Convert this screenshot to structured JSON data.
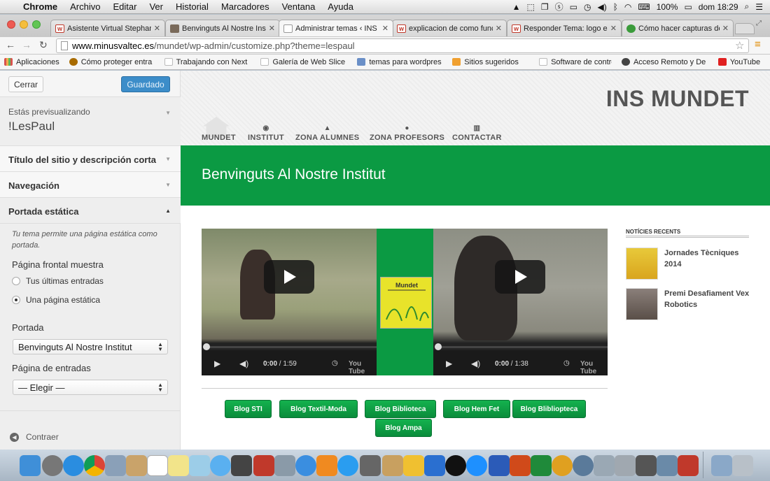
{
  "menubar": {
    "app": "Chrome",
    "items": [
      "Archivo",
      "Editar",
      "Ver",
      "Historial",
      "Marcadores",
      "Ventana",
      "Ayuda"
    ],
    "battery": "100%",
    "clock": "dom 18:29"
  },
  "tabs": [
    {
      "title": "Asistente Virtual Stephan",
      "color": "#c0392b",
      "icon": "wp-forum-icon"
    },
    {
      "title": "Benvinguts Al Nostre Insti",
      "color": "#7a6a5a",
      "icon": "site-thumb-icon"
    },
    {
      "title": "Administrar temas ‹ INS M",
      "color": "#dddddd",
      "icon": "page-icon"
    },
    {
      "title": "explicacion de como func",
      "color": "#c0392b",
      "icon": "wp-forum-icon"
    },
    {
      "title": "Responder Tema: logo en",
      "color": "#c0392b",
      "icon": "wp-forum-icon"
    },
    {
      "title": "Cómo hacer capturas de p",
      "color": "#3a9b3a",
      "icon": "shield-icon"
    }
  ],
  "url": {
    "host": "www.minusvaltec.es",
    "path": "/mundet/wp-admin/customize.php?theme=lespaul"
  },
  "bookmarks": [
    {
      "label": "Aplicaciones",
      "color": "#d9534f"
    },
    {
      "label": "Cómo proteger entra",
      "color": "#a86b00"
    },
    {
      "label": "Trabajando con Next",
      "color": "#cccccc"
    },
    {
      "label": "Galería de Web Slice",
      "color": "#cccccc"
    },
    {
      "label": "temas para wordpres",
      "color": "#6a8fc7"
    },
    {
      "label": "Sitios sugeridos",
      "color": "#f0a030"
    },
    {
      "label": "Software de control",
      "color": "#cccccc"
    },
    {
      "label": "Acceso Remoto y De",
      "color": "#444444"
    },
    {
      "label": "YouTube",
      "color": "#e02020"
    }
  ],
  "customizer": {
    "close_label": "Cerrar",
    "save_label": "Guardado",
    "preview_label": "Estás previsualizando",
    "theme_name": "!LesPaul",
    "sections": [
      "Título del sitio y descripción corta",
      "Navegación",
      "Portada estática"
    ],
    "static_desc": "Tu tema permite una página estática como portada.",
    "front_label": "Página frontal muestra",
    "radio_options": [
      "Tus últimas entradas",
      "Una página estática"
    ],
    "radio_selected": 1,
    "portada_label": "Portada",
    "portada_value": "Benvinguts Al Nostre Institut",
    "entries_label": "Página de entradas",
    "entries_value": "— Elegir —",
    "collapse_label": "Contraer"
  },
  "site": {
    "title": "INS MUNDET",
    "nav": [
      {
        "label": "MUNDET",
        "icon": "home-icon"
      },
      {
        "label": "INSTITUT",
        "icon": "eye-icon"
      },
      {
        "label": "ZONA ALUMNES",
        "icon": "graduation-cap-icon"
      },
      {
        "label": "ZONA PROFESORS",
        "icon": "user-icon"
      },
      {
        "label": "CONTACTAR",
        "icon": "map-icon"
      }
    ],
    "welcome": "Benvinguts Al Nostre Institut",
    "logo_text": "Mundet",
    "videos": [
      {
        "time": "0:00",
        "duration": "/ 1:59"
      },
      {
        "time": "0:00",
        "duration": "/ 1:38"
      }
    ],
    "youtube_label": "You Tube",
    "blog_buttons": [
      "Blog STI",
      "Blog Textil-Moda",
      "Blog Biblioteca",
      "Blog Hem Fet",
      "Blog Blibliopteca",
      "Blog Ampa"
    ],
    "news_title": "NOTÍCIES RECENTS",
    "news": [
      "Jornades Tècniques 2014",
      "Premi Desafiament Vex Robotics"
    ]
  },
  "colors": {
    "accent_green": "#0b9a43",
    "wp_blue": "#3c8dc9"
  }
}
